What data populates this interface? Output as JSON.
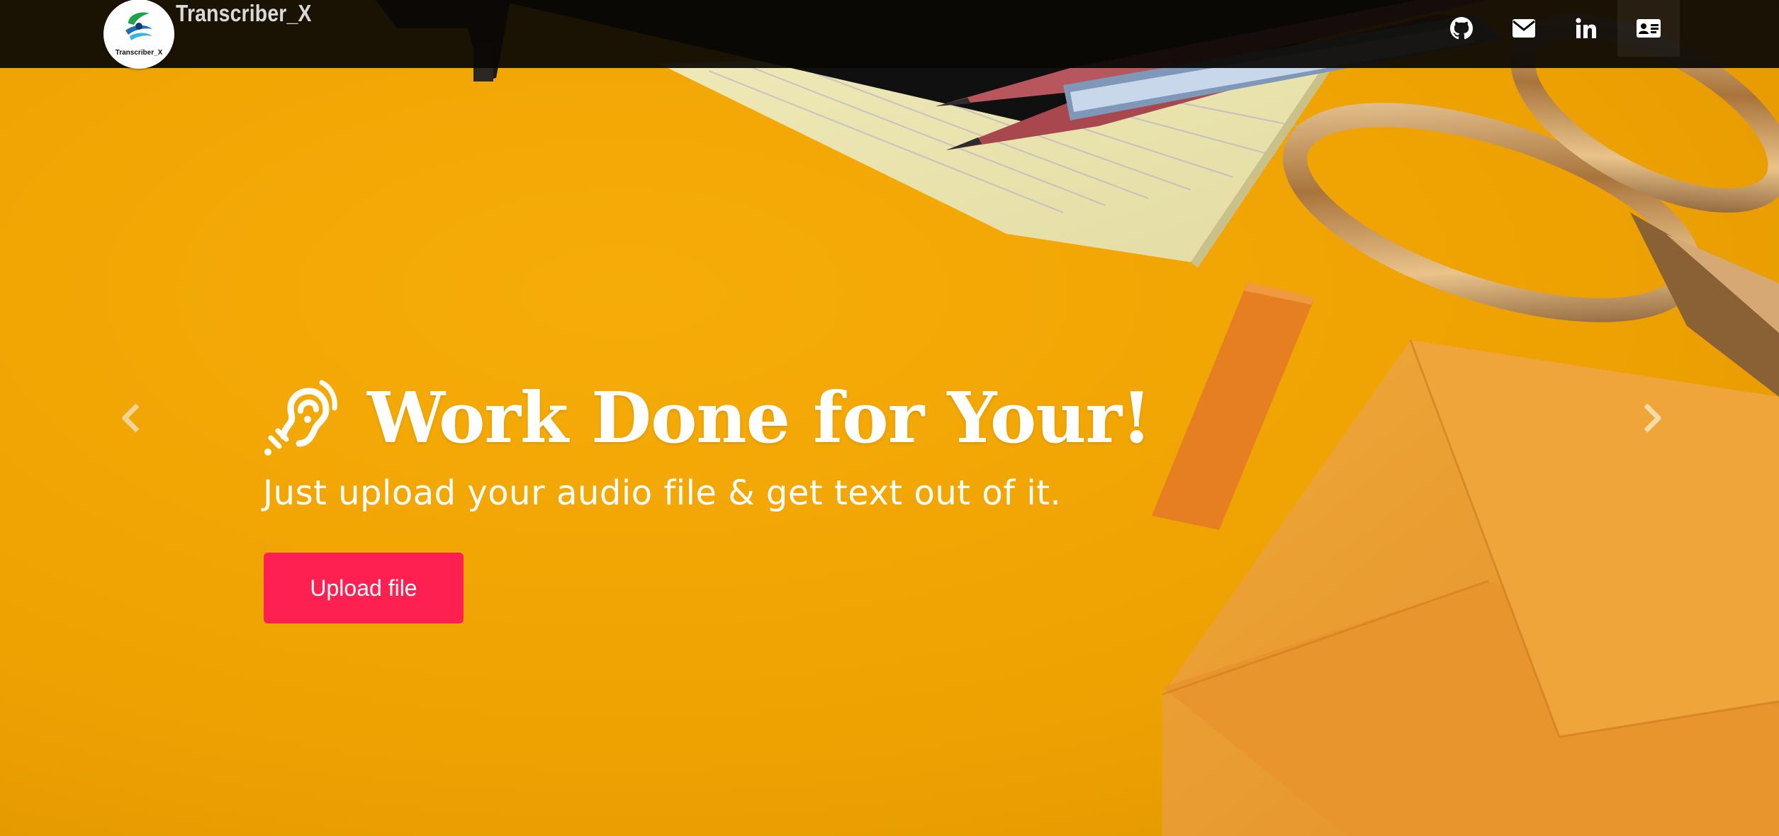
{
  "navbar": {
    "brand": "Transcriber_X",
    "logo_caption": "Transcriber_X",
    "icons": [
      {
        "name": "github-icon",
        "label": "GitHub"
      },
      {
        "name": "envelope-icon",
        "label": "Email"
      },
      {
        "name": "linkedin-icon",
        "label": "LinkedIn"
      },
      {
        "name": "contact-card-icon",
        "label": "Contact"
      }
    ]
  },
  "hero": {
    "icon": "hearing-ear-icon",
    "title": "Work Done for Your!",
    "subtitle": "Just upload your audio file & get text out of it.",
    "upload_label": "Upload file"
  },
  "carousel": {
    "prev_icon": "chevron-left-icon",
    "next_icon": "chevron-right-icon"
  },
  "colors": {
    "background": "#f0a400",
    "navbar": "#0a0804",
    "button": "#ff2052",
    "text": "#ffffff"
  }
}
